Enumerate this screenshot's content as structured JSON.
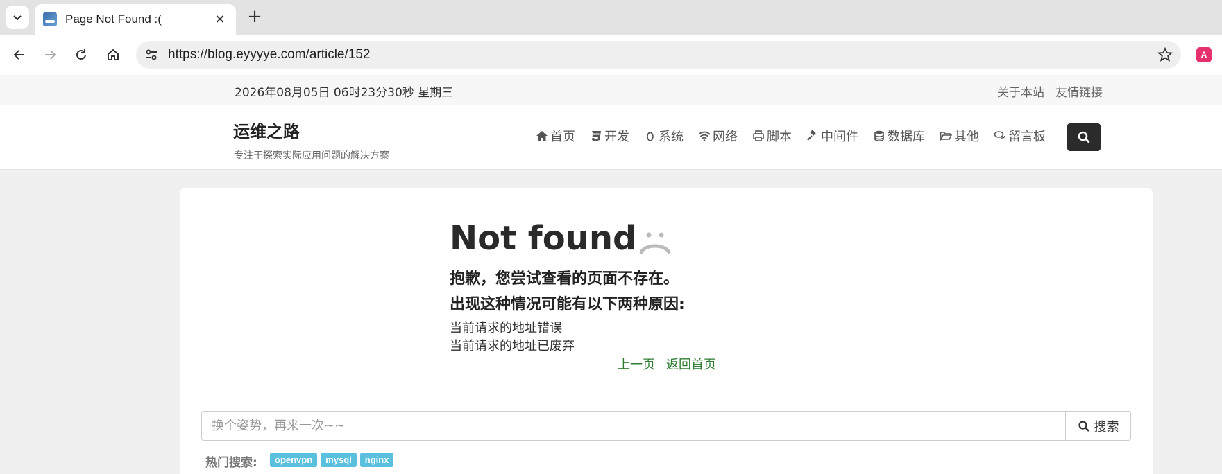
{
  "browser": {
    "tab_title": "Page Not Found :(",
    "url": "https://blog.eyyyye.com/article/152",
    "extension_label": "A"
  },
  "topbar": {
    "datetime": "2026年08月05日 06时23分30秒 星期三",
    "links": [
      "关于本站",
      "友情链接"
    ]
  },
  "site": {
    "title": "运维之路",
    "subtitle": "专注于探索实际应用问题的解决方案"
  },
  "nav": {
    "items": [
      {
        "label": "首页",
        "icon": "home-icon"
      },
      {
        "label": "开发",
        "icon": "css3-icon"
      },
      {
        "label": "系统",
        "icon": "linux-icon"
      },
      {
        "label": "网络",
        "icon": "wifi-icon"
      },
      {
        "label": "脚本",
        "icon": "printer-icon"
      },
      {
        "label": "中间件",
        "icon": "gavel-icon"
      },
      {
        "label": "数据库",
        "icon": "database-icon"
      },
      {
        "label": "其他",
        "icon": "folder-open-icon"
      },
      {
        "label": "留言板",
        "icon": "comments-icon"
      }
    ]
  },
  "not_found": {
    "title": "Not found",
    "line1": "抱歉，您尝试查看的页面不存在。",
    "line2": "出现这种情况可能有以下两种原因:",
    "reasons": [
      "当前请求的地址错误",
      "当前请求的地址已废弃"
    ],
    "prev_link": "上一页",
    "home_link": "返回首页"
  },
  "search": {
    "placeholder": "换个姿势，再来一次~~",
    "button_label": "搜索",
    "hot_label": "热门搜索:",
    "hot_tags": [
      "openvpn",
      "mysql",
      "nginx"
    ]
  },
  "colors": {
    "link_green": "#2e7d32",
    "tag_blue": "#5bc0de",
    "search_btn_dark": "#2b2b2b"
  }
}
